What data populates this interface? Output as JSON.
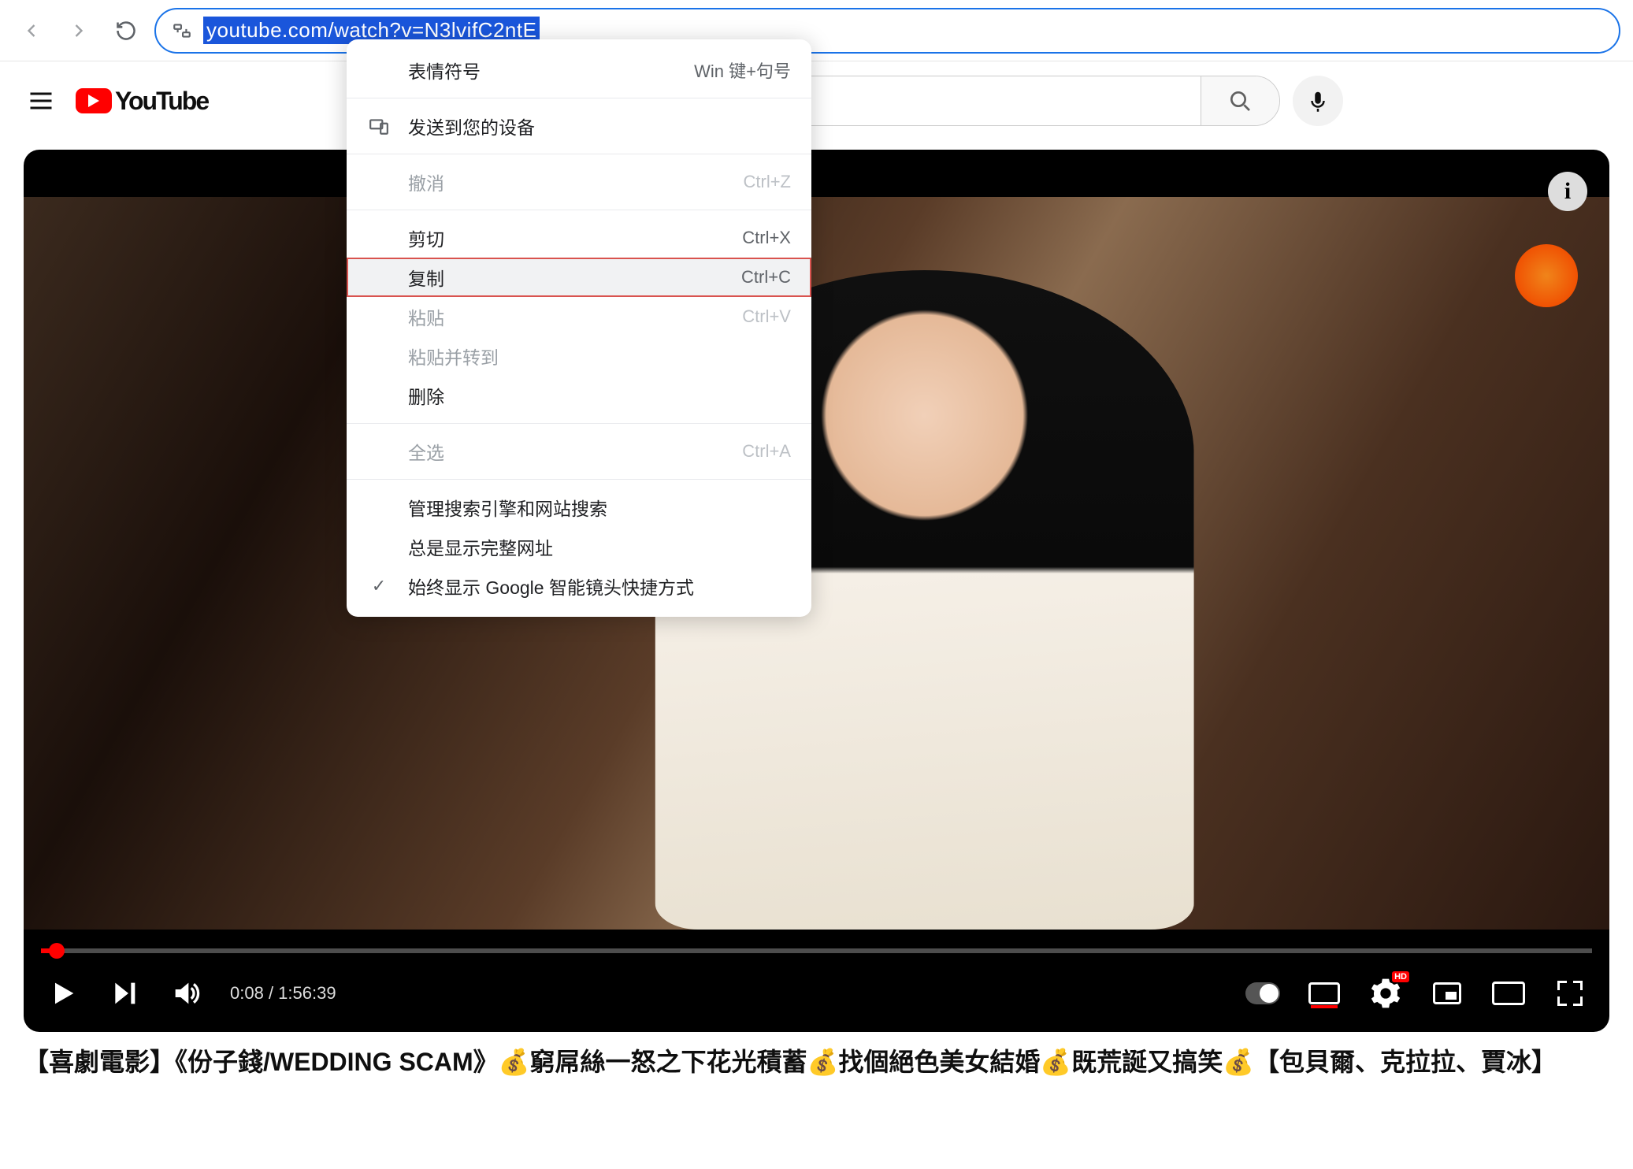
{
  "browser": {
    "url_selected": "youtube.com/watch?v=N3lvifC2ntE"
  },
  "youtube": {
    "brand": "YouTube"
  },
  "player": {
    "time_current": "0:08",
    "time_separator": " / ",
    "time_total": "1:56:39",
    "info_glyph": "i",
    "hd_label": "HD"
  },
  "video": {
    "title": "【喜劇電影】《份子錢/WEDDING SCAM》💰窮屌絲一怒之下花光積蓄💰找個絕色美女結婚💰既荒誕又搞笑💰【包貝爾、克拉拉、賈冰】"
  },
  "ctx": {
    "emoji": {
      "label": "表情符号",
      "shortcut": "Win 键+句号"
    },
    "send": {
      "label": "发送到您的设备"
    },
    "undo": {
      "label": "撤消",
      "shortcut": "Ctrl+Z"
    },
    "cut": {
      "label": "剪切",
      "shortcut": "Ctrl+X"
    },
    "copy": {
      "label": "复制",
      "shortcut": "Ctrl+C"
    },
    "paste": {
      "label": "粘贴",
      "shortcut": "Ctrl+V"
    },
    "pastego": {
      "label": "粘贴并转到"
    },
    "delete": {
      "label": "删除"
    },
    "selectall": {
      "label": "全选",
      "shortcut": "Ctrl+A"
    },
    "engines": {
      "label": "管理搜索引擎和网站搜索"
    },
    "fullurl": {
      "label": "总是显示完整网址"
    },
    "lens": {
      "label": "始终显示 Google 智能镜头快捷方式"
    }
  }
}
